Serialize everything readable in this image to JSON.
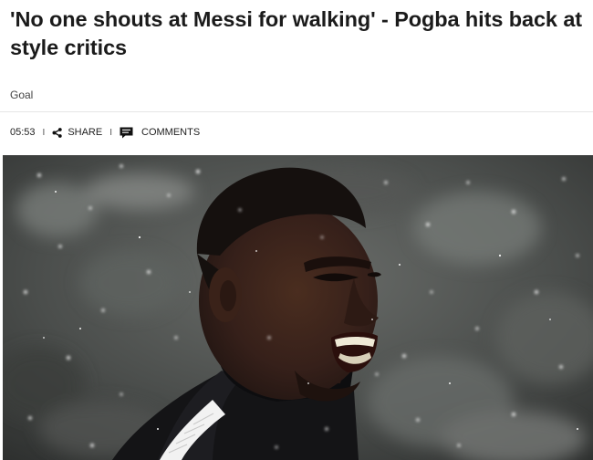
{
  "article": {
    "headline": "'No one shouts at Messi for walking' - Pogba hits back at style critics",
    "source": "Goal"
  },
  "meta": {
    "time": "05:53",
    "separator": "I",
    "share_label": "SHARE",
    "comments_label": "COMMENTS"
  },
  "image": {
    "subject": "player-grimacing-in-rain",
    "colors": {
      "jacket": "#141416",
      "stripe": "#f2f2f2",
      "skin": "#3b2418",
      "background": "#4d504e"
    }
  },
  "icons": {
    "share": "share-icon",
    "comments": "comment-icon"
  }
}
